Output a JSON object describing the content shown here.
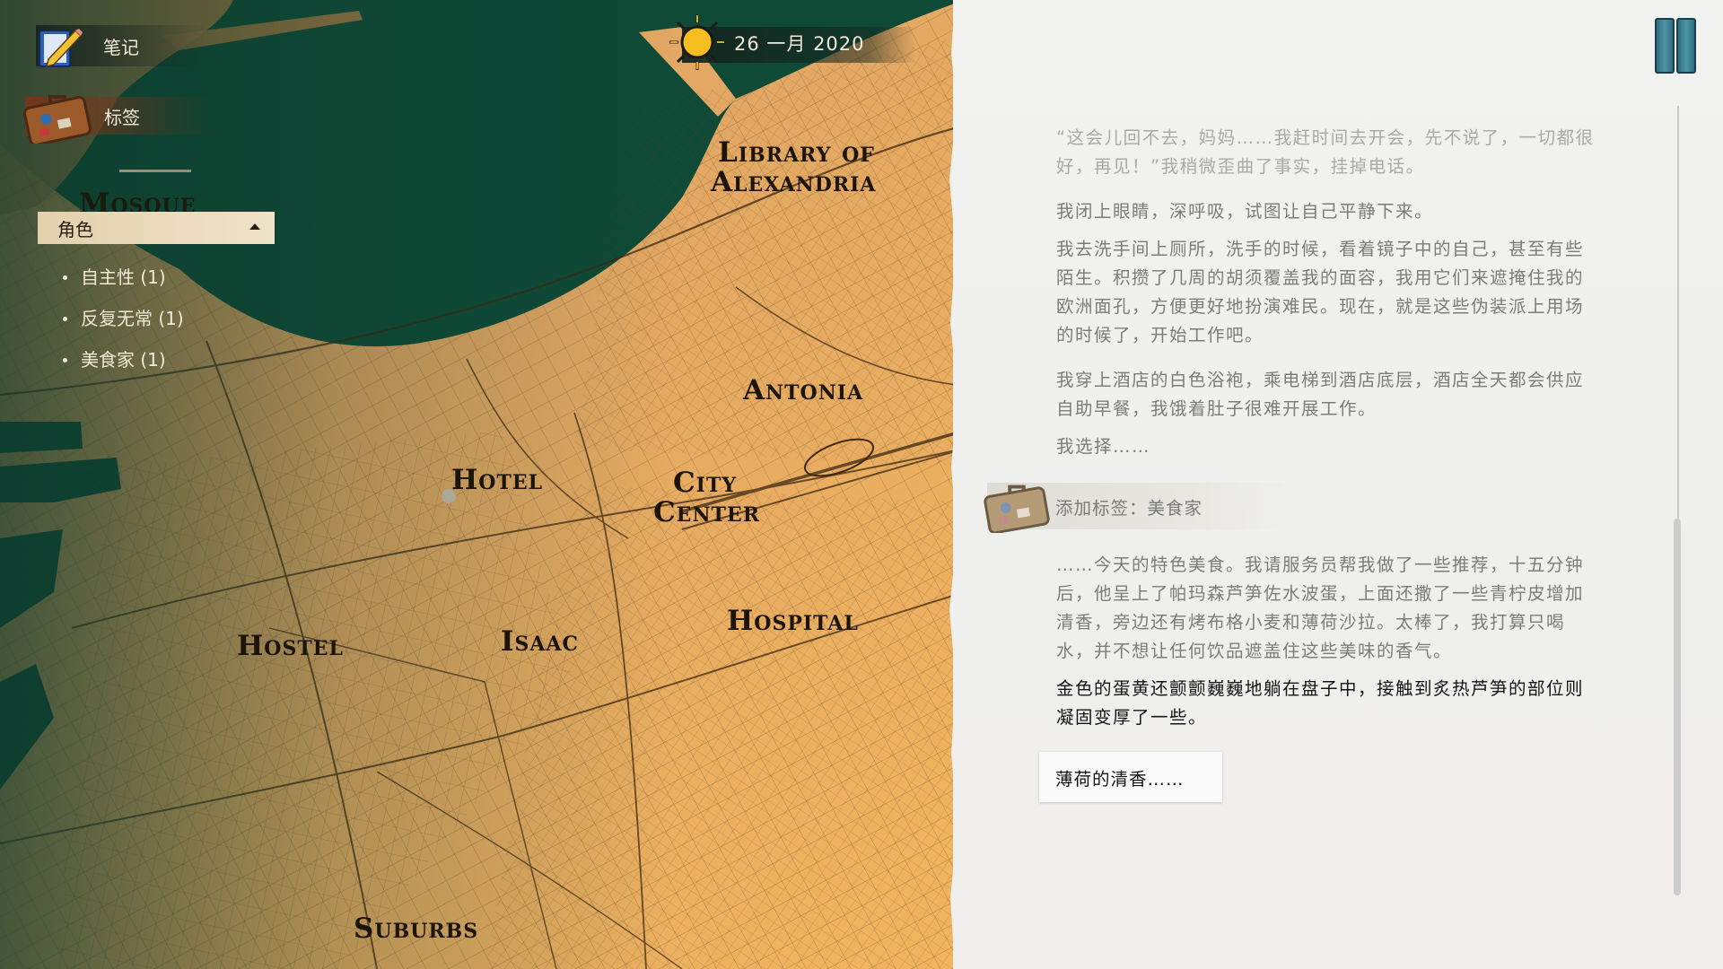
{
  "menu": {
    "notes_label": "笔记",
    "tags_label": "标签"
  },
  "date": {
    "text": "26 一月 2020",
    "weather_icon": "sun-icon"
  },
  "tag_filter": {
    "selected": "角色",
    "items": [
      {
        "label": "自主性 (1)"
      },
      {
        "label": "反复无常 (1)"
      },
      {
        "label": "美食家 (1)"
      }
    ]
  },
  "map": {
    "districts": {
      "mosque": "Mosque",
      "library": "Library of",
      "library2": "Alexandria",
      "antonia": "Antonia",
      "hotel": "Hotel",
      "city": "City",
      "center": "Center",
      "hostel": "Hostel",
      "isaac": "Isaac",
      "hospital": "Hospital",
      "suburbs": "Suburbs"
    },
    "colors": {
      "sea": "#0e3a2c",
      "land": "#e8ae66",
      "streets": "#5a3e22"
    }
  },
  "journal": {
    "paragraphs": [
      "“这会儿回不去，妈妈……我赶时间去开会，先不说了，一切都很好，再见！”我稍微歪曲了事实，挂掉电话。",
      "我闭上眼睛，深呼吸，试图让自己平静下来。",
      "我去洗手间上厕所，洗手的时候，看着镜子中的自己，甚至有些陌生。积攒了几周的胡须覆盖我的面容，我用它们来遮掩住我的欧洲面孔，方便更好地扮演难民。现在，就是这些伪装派上用场的时候了，开始工作吧。",
      "我穿上酒店的白色浴袍，乘电梯到酒店底层，酒店全天都会供应自助早餐，我饿着肚子很难开展工作。",
      "我选择……",
      "……今天的特色美食。我请服务员帮我做了一些推荐，十五分钟后，他呈上了帕玛森芦笋佐水波蛋，上面还撒了一些青柠皮增加清香，旁边还有烤布格小麦和薄荷沙拉。太棒了，我打算只喝水，并不想让任何饮品遮盖住这些美味的香气。",
      "金色的蛋黄还颤颤巍巍地躺在盘子中，接触到炙热芦笋的部位则凝固变厚了一些。"
    ],
    "tag_added": "添加标签：美食家",
    "choice": "薄荷的清香……"
  }
}
